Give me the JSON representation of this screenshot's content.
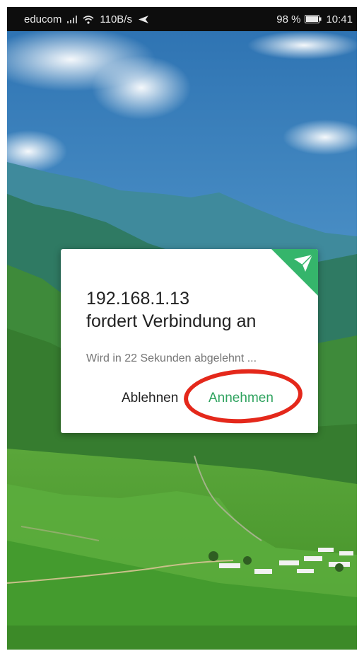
{
  "status_bar": {
    "carrier": "educom",
    "speed": "110B/s",
    "battery": "98 %",
    "time": "10:41",
    "icons": [
      "signal-icon",
      "wifi-icon",
      "nav-arrow-icon",
      "battery-icon"
    ]
  },
  "dialog": {
    "title_line1": "192.168.1.13",
    "title_line2": "fordert Verbindung an",
    "subtitle": "Wird in 22 Sekunden abgelehnt ...",
    "decline_label": "Ablehnen",
    "accept_label": "Annehmen",
    "corner_icon": "paper-plane-icon"
  },
  "colors": {
    "accent_green": "#35b56b",
    "accept_text": "#2fa35f",
    "highlight_red": "#e4281b"
  }
}
